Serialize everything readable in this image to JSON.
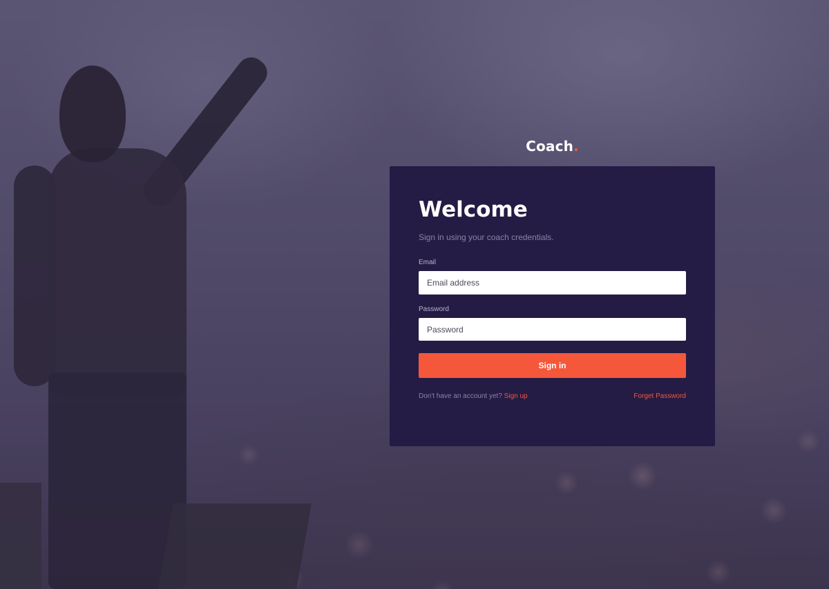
{
  "brand": {
    "name": "Coach",
    "dot": "."
  },
  "login": {
    "title": "Welcome",
    "subtitle": "Sign in using your coach credentials.",
    "email_label": "Email",
    "email_placeholder": "Email address",
    "email_value": "",
    "password_label": "Password",
    "password_placeholder": "Password",
    "password_value": "",
    "submit_label": "Sign in",
    "no_account_text": "Don't have an account yet?",
    "signup_link": "Sign up",
    "forgot_link": "Forget Password"
  },
  "colors": {
    "accent": "#f5573b",
    "card_bg": "#241c44",
    "subtitle": "#8a84a8"
  },
  "background": {
    "icon": "concert-crowd-photo"
  }
}
